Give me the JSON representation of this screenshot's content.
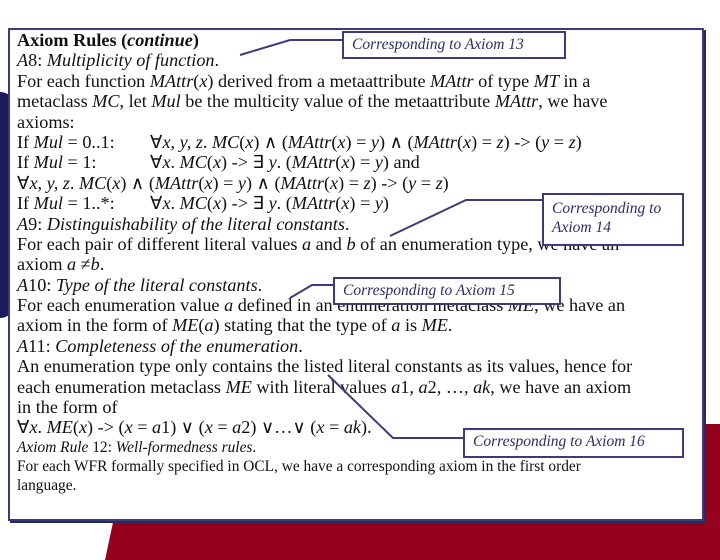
{
  "slide": {
    "title_bold": "Axiom Rules (",
    "title_italic": "continue",
    "title_close": ")",
    "lines": {
      "a8_label": "A",
      "a8_num": "8: ",
      "a8_title": "Multiplicity of function",
      "a8_dot": ".",
      "l3": [
        "For each function ",
        "MAttr",
        "(",
        "x",
        ") derived from a metaattribute ",
        "MAttr",
        " of type ",
        "MT",
        " in a"
      ],
      "l4": [
        "metaclass ",
        "MC",
        ", let ",
        "Mul",
        " be the multicity value of the metaattribute ",
        "MAttr",
        ", we have"
      ],
      "l5": "axioms:",
      "l6_cond": [
        "If ",
        "Mul",
        " = 0..1:"
      ],
      "l6_formula": [
        "∀",
        "x, y, z",
        ". ",
        "MC",
        "(",
        "x",
        ") ∧ (",
        "MAttr",
        "(",
        "x",
        ") = ",
        "y",
        ") ∧ (",
        "MAttr",
        "(",
        "x",
        ") = ",
        "z",
        ") -> (",
        "y",
        " = ",
        "z",
        ")"
      ],
      "l7_cond": [
        "If ",
        "Mul",
        " = 1:"
      ],
      "l7_formula": [
        "∀",
        "x",
        ". ",
        "MC",
        "(",
        "x",
        ") -> ∃ ",
        "y",
        ". (",
        "MAttr",
        "(",
        "x",
        ") = ",
        "y",
        ") and"
      ],
      "l8": [
        "∀",
        "x, y, z",
        ". ",
        "MC",
        "(",
        "x",
        ") ∧ (",
        "MAttr",
        "(",
        "x",
        ") = ",
        "y",
        ") ∧ (",
        "MAttr",
        "(",
        "x",
        ") = ",
        "z",
        ") -> (",
        "y",
        " = ",
        "z",
        ")"
      ],
      "l9_cond": [
        "If ",
        "Mul",
        " = 1..*:"
      ],
      "l9_formula": [
        "∀",
        "x",
        ". ",
        "MC",
        "(",
        "x",
        ") -> ∃ ",
        "y",
        ". (",
        "MAttr",
        "(",
        "x",
        ") = ",
        "y",
        ")"
      ],
      "a9_label": "A",
      "a9_num": "9: ",
      "a9_title": "Distinguishability of the literal constants",
      "a9_dot": ".",
      "l11": [
        "For each pair of different literal values ",
        "a",
        " and ",
        "b",
        " of an enumeration type, we have an"
      ],
      "l12": [
        "axiom ",
        "a",
        " ≠",
        "b",
        "."
      ],
      "a10_label": "A",
      "a10_num": "10: ",
      "a10_title": "Type of the literal constants",
      "a10_dot": ".",
      "l14": [
        "For each enumeration value ",
        "a",
        " defined in an enumeration metaclass ",
        "ME",
        ", we have an"
      ],
      "l15": [
        "axiom in the form of ",
        "ME",
        "(",
        "a",
        ") stating that the type of ",
        "a",
        " is ",
        "ME",
        "."
      ],
      "a11_label": "A",
      "a11_num": "11: ",
      "a11_title": "Completeness of the enumeration",
      "a11_dot": ".",
      "l17": "An enumeration type only contains the listed literal constants as its values, hence for",
      "l18": [
        "each enumeration metaclass ",
        "ME",
        " with literal values ",
        "a",
        "1, ",
        "a",
        "2, …, ",
        "ak",
        ", we have an axiom"
      ],
      "l19": "in the form of",
      "l20": [
        "∀",
        "x",
        ". ",
        "ME",
        "(",
        "x",
        ") -> (",
        "x",
        " = ",
        "a",
        "1) ∨ (",
        "x",
        " = ",
        "a",
        "2) ∨…∨ (",
        "x",
        " = ",
        "ak",
        ")."
      ],
      "r12_label": "Axiom Rule",
      "r12_num": " 12: ",
      "r12_title": "Well-formedness rules",
      "r12_dot": ".",
      "l22": "For each WFR formally specified in OCL, we have a corresponding axiom in the first order",
      "l23": "language."
    },
    "callouts": {
      "c13": "Corresponding to Axiom 13",
      "c14_line1": "Corresponding to",
      "c14_line2": "Axiom 14",
      "c15": "Corresponding to Axiom 15",
      "c16": "Corresponding to Axiom 16"
    },
    "colors": {
      "frame": "#3b3b7e",
      "callout_text": "#2b2b6e",
      "left_decoration": "#1c1c5c",
      "bottom_decoration": "#95001f"
    }
  }
}
